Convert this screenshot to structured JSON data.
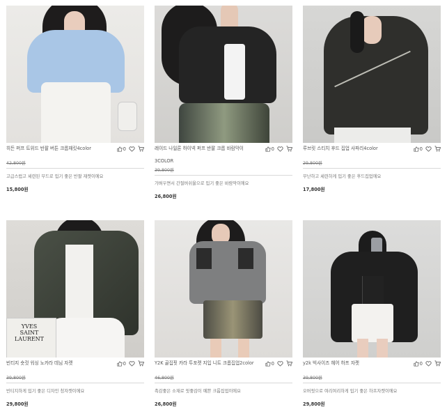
{
  "products": [
    {
      "name": "히든 퍼프 트위드 반팔 버튼 크롭재킷4color",
      "subname": "",
      "likes": "0",
      "original_price": "42,800원",
      "description": "고급스럽고 세련된 무드로 입기 좋은 반팔 재켓이에요",
      "sale_price": "15,800원"
    },
    {
      "name": "레이드 나일론 하이넥 퍼프 반팔 크롭 바람막이",
      "subname": "3COLOR",
      "likes": "0",
      "original_price": "39,800원",
      "description": "가벼우면서 간절버쉬울으로 입기 좋은 바람막이에요",
      "sale_price": "26,800원"
    },
    {
      "name": "루브릿 스티치 후드 집업 사파리4color",
      "subname": "",
      "likes": "0",
      "original_price": "29,800원",
      "description": "무난하고 세련하게 입기 좋은 후드집업에요",
      "sale_price": "17,800원"
    },
    {
      "name": "빈티지 숏컷 워싱 노카라 데님 자켓",
      "subname": "",
      "likes": "0",
      "original_price": "39,800원",
      "description": "빈티지하게 입기 좋은 디자인 청자켓이에요",
      "sale_price": "29,800원"
    },
    {
      "name": "Y2K 골집핏 카라 투포켓 지입 니트 크롭집업2color",
      "subname": "",
      "likes": "0",
      "original_price": "46,800원",
      "description": "촉감좋은 소재로 핏좋감이 예쁜 크롭집업이에요",
      "sale_price": "26,800원"
    },
    {
      "name": "y2k 빅사이즈 헤어 하프 자켓",
      "subname": "",
      "likes": "0",
      "original_price": "39,800원",
      "description": "오버핏으로 여리여리하게 입기 좋은 하프자켓이에요",
      "sale_price": "29,800원"
    }
  ],
  "icons": {
    "like": "thumbs-up-icon",
    "wish": "heart-icon",
    "cart": "cart-icon"
  },
  "photo_tones": [
    "#e9e6e2",
    "#d9d8d6",
    "#d3d3d1",
    "#d8d6d3",
    "#e4e2e0",
    "#d6d6d6"
  ]
}
